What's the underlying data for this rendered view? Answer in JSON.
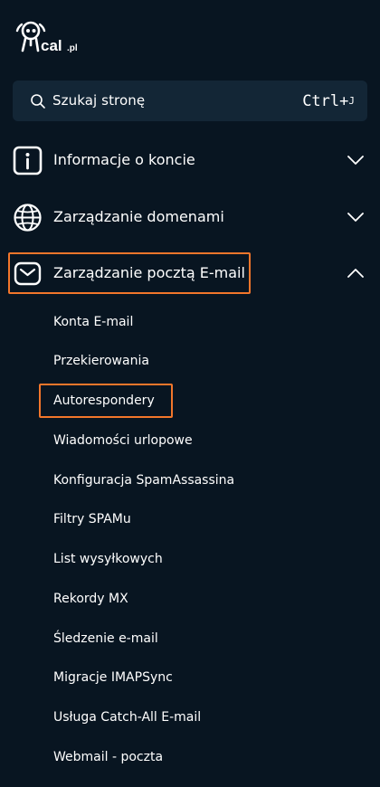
{
  "brand": {
    "name": "cal.pl"
  },
  "search": {
    "label": "Szukaj stronę",
    "shortcut_main": "Ctrl+",
    "shortcut_key": "J"
  },
  "sections": [
    {
      "label": "Informacje o koncie",
      "icon": "info-icon",
      "expanded": false
    },
    {
      "label": "Zarządzanie domenami",
      "icon": "globe-icon",
      "expanded": false
    },
    {
      "label": "Zarządzanie pocztą E-mail",
      "icon": "envelope-icon",
      "expanded": true
    }
  ],
  "email_items": [
    "Konta E-mail",
    "Przekierowania",
    "Autorespondery",
    "Wiadomości urlopowe",
    "Konfiguracja SpamAssassina",
    "Filtry SPAMu",
    "List wysyłkowych",
    "Rekordy MX",
    "Śledzenie e-mail",
    "Migracje IMAPSync",
    "Usługa Catch-All E-mail",
    "Webmail - poczta"
  ],
  "colors": {
    "background": "#081521",
    "search_bg": "#132636",
    "highlight": "#f2762b",
    "text": "#ffffff"
  }
}
